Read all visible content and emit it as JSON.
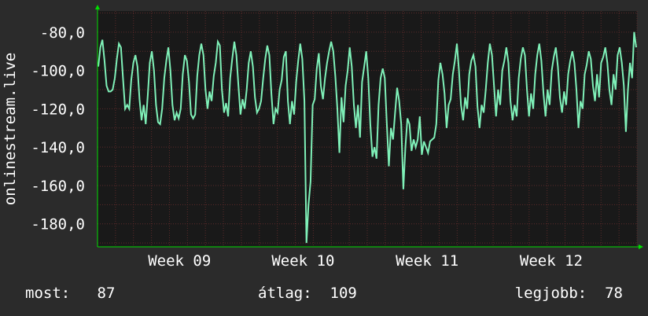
{
  "chart_data": {
    "type": "line",
    "ylabel": "onlinestream.live",
    "ylim": [
      -192,
      -69
    ],
    "yticks": [
      "-80,0",
      "-100,0",
      "-120,0",
      "-140,0",
      "-160,0",
      "-180,0"
    ],
    "yticks_values": [
      -80,
      -100,
      -120,
      -140,
      -160,
      -180
    ],
    "x_ticks": [
      "Week 09",
      "Week 10",
      "Week 11",
      "Week 12"
    ],
    "x_tick_positions": [
      0.152,
      0.381,
      0.611,
      0.841
    ],
    "grid": true,
    "colors": {
      "background": "#2b2b2b",
      "plot_bg": "#191919",
      "grid": "#5c2a2a",
      "line": "#7ff0b8",
      "arrow": "#00e000",
      "text": "#ffffff"
    },
    "series": [
      {
        "values": [
          -98,
          -88,
          -84,
          -95,
          -108,
          -111,
          -111,
          -110,
          -104,
          -94,
          -86,
          -88,
          -104,
          -120,
          -118,
          -120,
          -105,
          -96,
          -92,
          -98,
          -115,
          -126,
          -118,
          -128,
          -113,
          -96,
          -90,
          -100,
          -118,
          -127,
          -128,
          -120,
          -104,
          -95,
          -88,
          -100,
          -118,
          -126,
          -122,
          -125,
          -120,
          -102,
          -92,
          -95,
          -106,
          -123,
          -125,
          -123,
          -103,
          -92,
          -86,
          -92,
          -110,
          -120,
          -111,
          -116,
          -103,
          -96,
          -85,
          -87,
          -110,
          -122,
          -117,
          -124,
          -104,
          -94,
          -85,
          -92,
          -108,
          -123,
          -115,
          -120,
          -110,
          -96,
          -90,
          -98,
          -114,
          -122,
          -120,
          -116,
          -104,
          -94,
          -87,
          -92,
          -112,
          -128,
          -120,
          -122,
          -110,
          -105,
          -93,
          -90,
          -116,
          -128,
          -116,
          -123,
          -106,
          -95,
          -86,
          -94,
          -116,
          -190,
          -170,
          -158,
          -118,
          -115,
          -99,
          -91,
          -108,
          -115,
          -104,
          -96,
          -90,
          -85,
          -90,
          -103,
          -120,
          -143,
          -114,
          -127,
          -108,
          -100,
          -88,
          -98,
          -118,
          -130,
          -118,
          -135,
          -106,
          -98,
          -90,
          -104,
          -128,
          -145,
          -140,
          -146,
          -118,
          -104,
          -99,
          -104,
          -128,
          -150,
          -130,
          -136,
          -122,
          -109,
          -116,
          -128,
          -162,
          -140,
          -125,
          -128,
          -142,
          -136,
          -140,
          -136,
          -124,
          -144,
          -137,
          -140,
          -143,
          -137,
          -136,
          -135,
          -128,
          -105,
          -96,
          -102,
          -112,
          -130,
          -118,
          -115,
          -102,
          -95,
          -86,
          -100,
          -118,
          -126,
          -114,
          -120,
          -102,
          -95,
          -92,
          -98,
          -119,
          -130,
          -118,
          -122,
          -110,
          -96,
          -86,
          -92,
          -108,
          -124,
          -110,
          -118,
          -100,
          -95,
          -88,
          -96,
          -116,
          -126,
          -118,
          -124,
          -104,
          -94,
          -88,
          -92,
          -110,
          -124,
          -112,
          -120,
          -102,
          -92,
          -86,
          -95,
          -112,
          -124,
          -110,
          -118,
          -100,
          -93,
          -88,
          -98,
          -114,
          -122,
          -111,
          -118,
          -102,
          -95,
          -90,
          -96,
          -110,
          -130,
          -116,
          -120,
          -102,
          -97,
          -90,
          -94,
          -108,
          -116,
          -102,
          -114,
          -96,
          -93,
          -88,
          -96,
          -110,
          -118,
          -102,
          -110,
          -92,
          -88,
          -96,
          -108,
          -132,
          -110,
          -96,
          -104,
          -80,
          -88
        ]
      }
    ]
  },
  "stats": {
    "now": "most:   87",
    "avg": "átlag:  109",
    "best": "legjobb:  78"
  }
}
